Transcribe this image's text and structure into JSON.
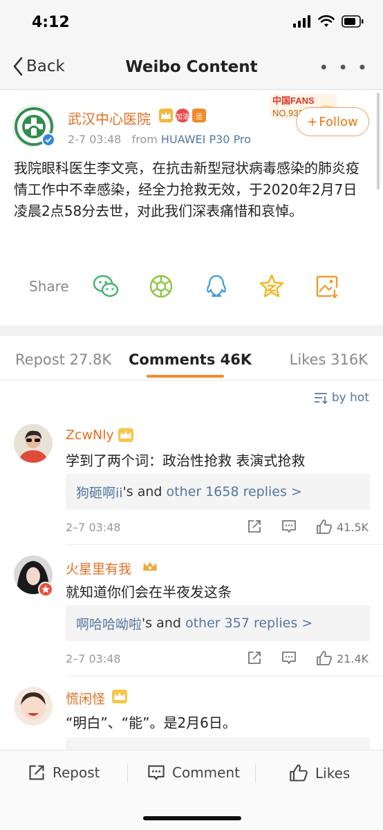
{
  "status_bar": {
    "time": "4:12"
  },
  "nav": {
    "back_label": "Back",
    "title": "Weibo Content",
    "more_label": "• • •"
  },
  "post": {
    "author": "武汉中心医院",
    "badges": [
      "crown-badge",
      "加油",
      "运"
    ],
    "time": "2-7 03:48",
    "from_prefix": "from",
    "device": "HUAWEI P30 Pro",
    "follow_label": "Follow",
    "fans_badge": {
      "title": "中国FANS",
      "number": "NO.933"
    },
    "text": "我院眼科医生李文亮，在抗击新型冠状病毒感染的肺炎疫情工作中不幸感染，经全力抢救无效，于2020年2月7日凌晨2点58分去世，对此我们深表痛惜和哀悼。"
  },
  "share": {
    "label": "Share",
    "targets": [
      "wechat-icon",
      "moments-icon",
      "qq-icon",
      "qzone-icon",
      "save-image-icon"
    ]
  },
  "tabs": {
    "repost": "Repost 27.8K",
    "comments": "Comments 46K",
    "likes": "Likes 316K",
    "active": "comments"
  },
  "sort": {
    "label": "by hot"
  },
  "comments": [
    {
      "name": "ZcwNly",
      "text": "学到了两个词：政治性抢救 表演式抢救",
      "replies_user": "狗砸啊ii",
      "replies_mid": "'s and",
      "replies_link": "other 1658 replies >",
      "time": "2–7 03:48",
      "likes": "41.5K"
    },
    {
      "name": "火星里有我",
      "text": "就知道你们会在半夜发这条",
      "replies_user": "啊哈哈呦啦",
      "replies_mid": "'s and",
      "replies_link": "other 357 replies >",
      "time": "2–7 03:48",
      "likes": "21.4K"
    },
    {
      "name": "慌闲怪",
      "text": "“明白”、“能”。是2月6日。"
    }
  ],
  "bottom_bar": {
    "repost": "Repost",
    "comment": "Comment",
    "likes": "Likes"
  },
  "colors": {
    "accent_orange": "#e86d21",
    "link_blue": "#5476a1",
    "verified_blue": "#2e87e0"
  }
}
